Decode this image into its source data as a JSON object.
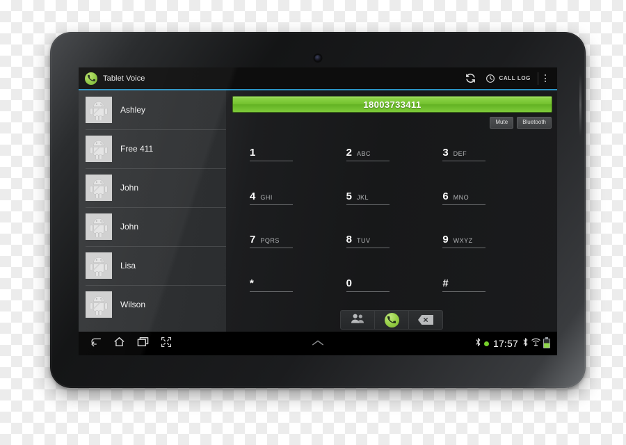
{
  "device": {
    "name": "android-tablet",
    "camera": "front-camera-lens"
  },
  "actionbar": {
    "app_title": "Tablet Voice",
    "logo_icon": "phone-handset-icon",
    "refresh_icon": "refresh-icon",
    "calllog_icon": "clock-icon",
    "calllog_label": "CALL LOG",
    "overflow_icon": "overflow-menu-icon",
    "accent_color": "#2a93c4"
  },
  "contacts": {
    "items": [
      {
        "name": "Ashley",
        "avatar": "android-robot-avatar"
      },
      {
        "name": "Free 411",
        "avatar": "android-robot-avatar"
      },
      {
        "name": "John",
        "avatar": "android-robot-avatar"
      },
      {
        "name": "John",
        "avatar": "android-robot-avatar"
      },
      {
        "name": "Lisa",
        "avatar": "android-robot-avatar"
      },
      {
        "name": "Wilson",
        "avatar": "android-robot-avatar"
      }
    ]
  },
  "dialer": {
    "number": "18003733411",
    "number_bar_color": "#74c22f",
    "toggles": [
      {
        "label": "Mute"
      },
      {
        "label": "Bluetooth"
      }
    ],
    "keys": [
      {
        "digit": "1",
        "letters": ""
      },
      {
        "digit": "2",
        "letters": "ABC"
      },
      {
        "digit": "3",
        "letters": "DEF"
      },
      {
        "digit": "4",
        "letters": "GHI"
      },
      {
        "digit": "5",
        "letters": "JKL"
      },
      {
        "digit": "6",
        "letters": "MNO"
      },
      {
        "digit": "7",
        "letters": "PQRS"
      },
      {
        "digit": "8",
        "letters": "TUV"
      },
      {
        "digit": "9",
        "letters": "WXYZ"
      },
      {
        "digit": "*",
        "letters": ""
      },
      {
        "digit": "0",
        "letters": ""
      },
      {
        "digit": "#",
        "letters": ""
      }
    ],
    "actions": [
      {
        "name": "contacts-button",
        "icon": "people-icon"
      },
      {
        "name": "call-button",
        "icon": "phone-handset-icon"
      },
      {
        "name": "backspace-button",
        "icon": "backspace-icon"
      }
    ]
  },
  "navbar": {
    "back_icon": "back-icon",
    "home_icon": "home-icon",
    "recents_icon": "recent-apps-icon",
    "screenshot_icon": "screenshot-icon",
    "notification_handle_icon": "chevron-up-icon",
    "status": {
      "bluetooth_icon": "bluetooth-icon",
      "activity_dot": "green-status-dot",
      "time": "17:57",
      "bluetooth_icon_2": "bluetooth-icon",
      "wifi_icon": "wifi-icon",
      "battery_icon": "battery-icon"
    }
  }
}
